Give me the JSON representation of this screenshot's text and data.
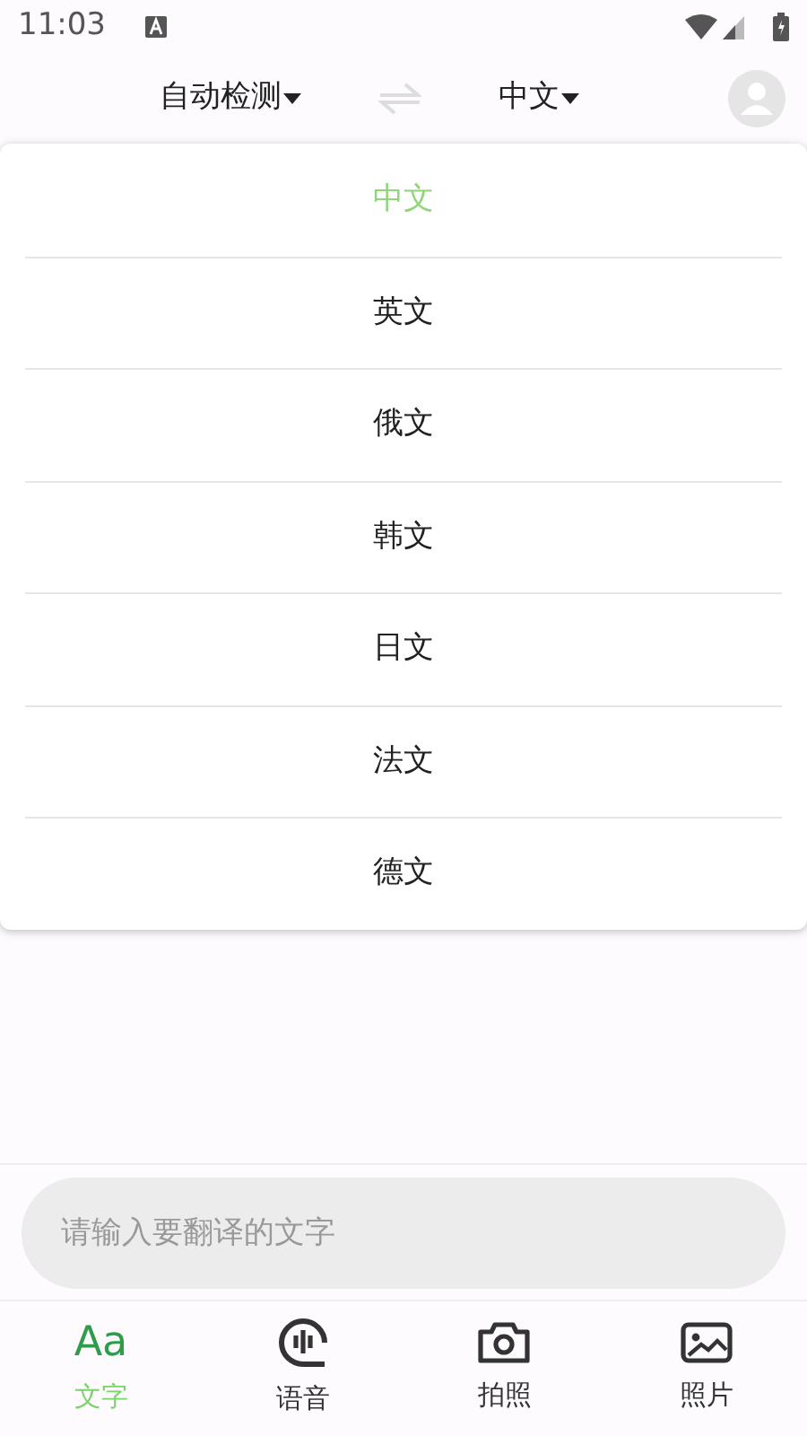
{
  "status_bar": {
    "time": "11:03"
  },
  "header": {
    "source_language": "自动检测",
    "target_language": "中文"
  },
  "language_menu": [
    {
      "label": "中文",
      "selected": true
    },
    {
      "label": "英文",
      "selected": false
    },
    {
      "label": "俄文",
      "selected": false
    },
    {
      "label": "韩文",
      "selected": false
    },
    {
      "label": "日文",
      "selected": false
    },
    {
      "label": "法文",
      "selected": false
    },
    {
      "label": "德文",
      "selected": false
    }
  ],
  "input": {
    "placeholder": "请输入要翻译的文字"
  },
  "tabs": [
    {
      "kind": "glyph",
      "glyph": "Aa",
      "label": "文字",
      "selected": true
    },
    {
      "kind": "voice",
      "label": "语音",
      "selected": false
    },
    {
      "kind": "camera",
      "label": "拍照",
      "selected": false
    },
    {
      "kind": "photo",
      "label": "照片",
      "selected": false
    }
  ]
}
